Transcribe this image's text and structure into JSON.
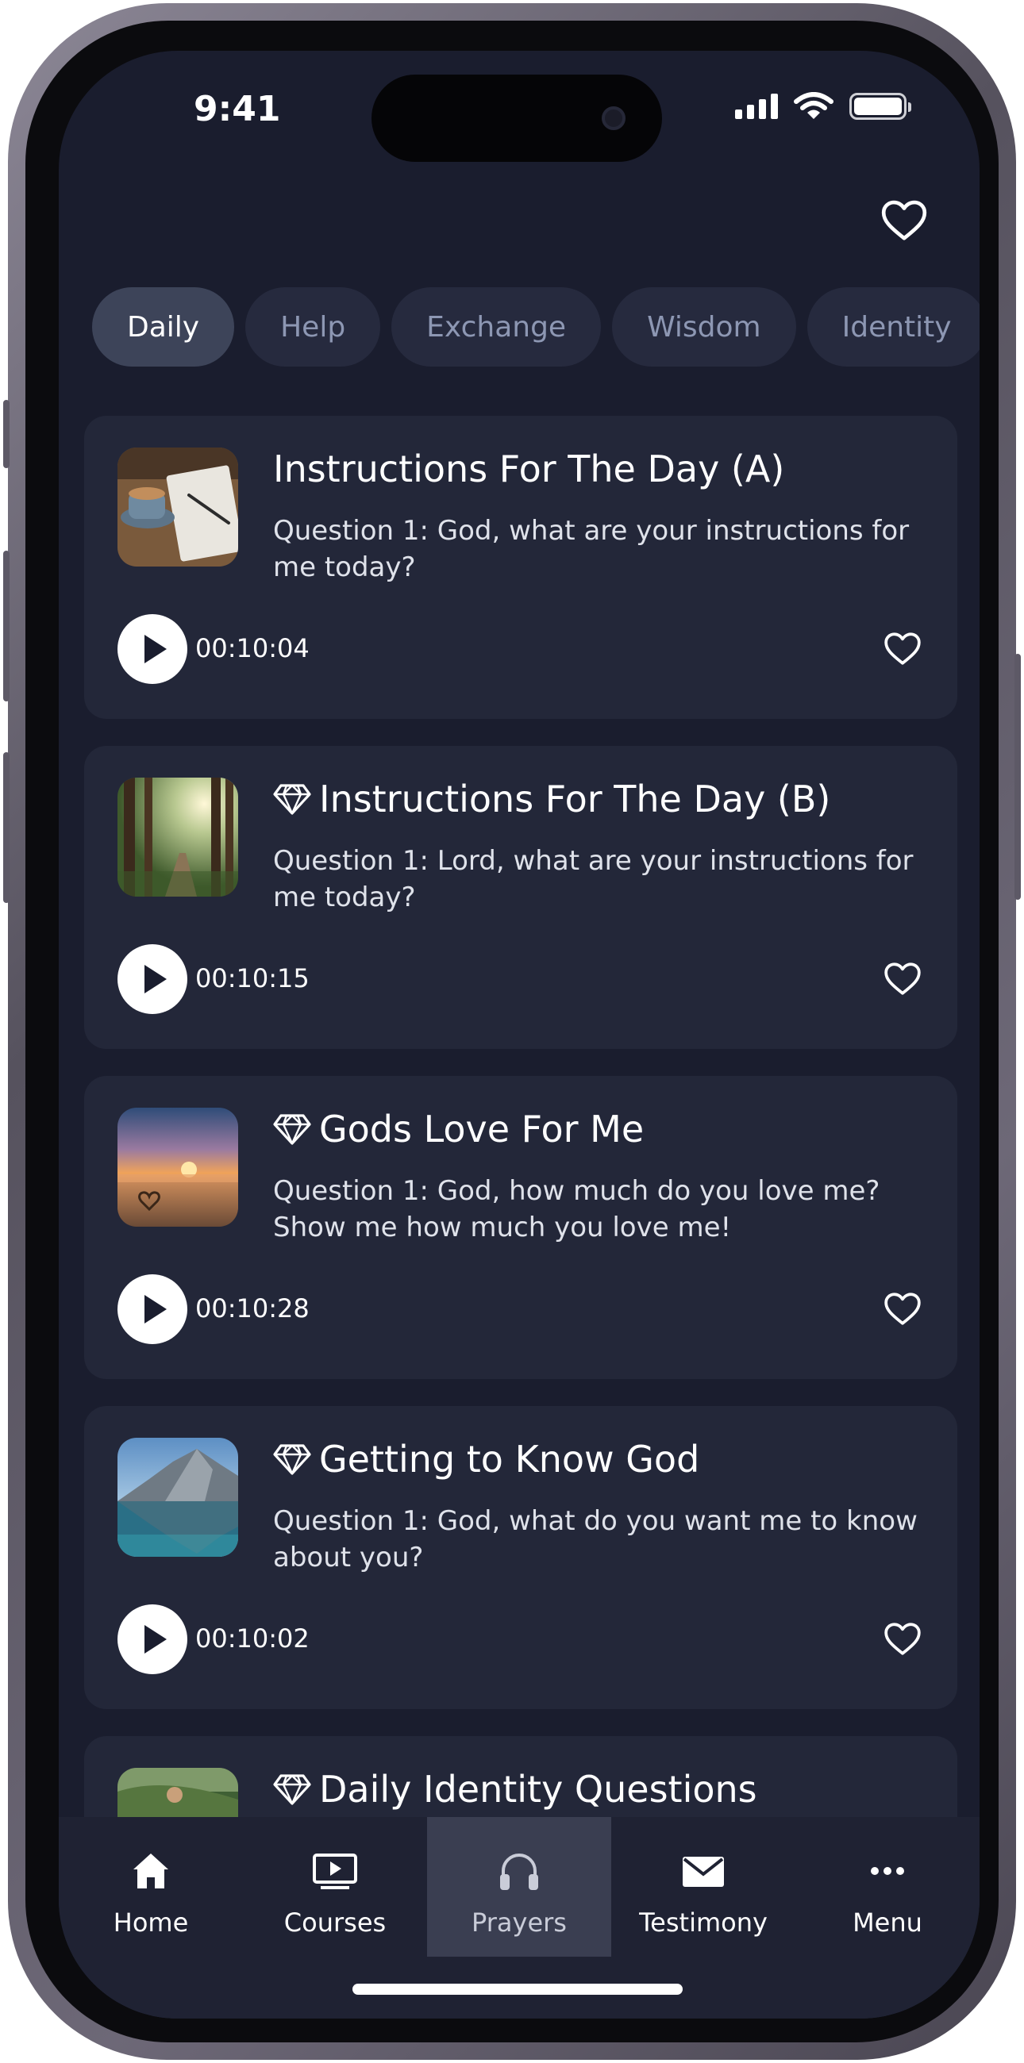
{
  "status_bar": {
    "time": "9:41"
  },
  "tabs": [
    {
      "label": "Daily",
      "active": true
    },
    {
      "label": "Help",
      "active": false
    },
    {
      "label": "Exchange",
      "active": false
    },
    {
      "label": "Wisdom",
      "active": false
    },
    {
      "label": "Identity",
      "active": false
    }
  ],
  "prayers": [
    {
      "title": "Instructions For The Day (A)",
      "premium": false,
      "description": "Question 1: God, what are your instructions for me today?",
      "duration": "00:10:04",
      "thumbnail_icon": "coffee-notebook-image"
    },
    {
      "title": "Instructions For The Day (B)",
      "premium": true,
      "description": "Question 1: Lord, what are your instructions for me today?",
      "duration": "00:10:15",
      "thumbnail_icon": "forest-light-image"
    },
    {
      "title": "Gods Love For Me",
      "premium": true,
      "description": "Question 1: God, how much do you love me? Show me how much you love me!",
      "duration": "00:10:28",
      "thumbnail_icon": "beach-sunset-heart-image"
    },
    {
      "title": "Getting to Know God",
      "premium": true,
      "description": "Question 1: God, what do you want me to know about you?",
      "duration": "00:10:02",
      "thumbnail_icon": "mountain-lake-image"
    },
    {
      "title": "Daily Identity Questions",
      "premium": true,
      "description": "",
      "duration": "",
      "thumbnail_icon": "hillside-image"
    }
  ],
  "nav": [
    {
      "label": "Home",
      "icon": "home-icon",
      "active": false
    },
    {
      "label": "Courses",
      "icon": "courses-icon",
      "active": false
    },
    {
      "label": "Prayers",
      "icon": "headphones-icon",
      "active": true
    },
    {
      "label": "Testimony",
      "icon": "envelope-icon",
      "active": false
    },
    {
      "label": "Menu",
      "icon": "more-icon",
      "active": false
    }
  ],
  "colors": {
    "background": "#1a1d2e",
    "card": "#232739",
    "tab": "#262a3e",
    "tab_active": "#3d4459",
    "nav_active": "#3a3e51"
  }
}
